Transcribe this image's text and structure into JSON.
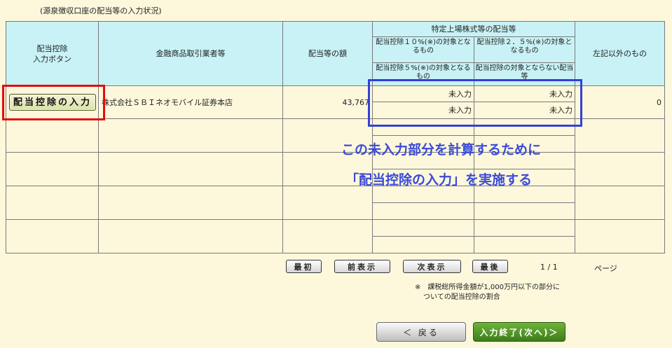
{
  "caption": "(源泉徴収口座の配当等の入力状況)",
  "table": {
    "headers": {
      "col1": "配当控除\n入力ボタン",
      "col2": "金融商品取引業者等",
      "col3": "配当等の額",
      "group": "特定上場株式等の配当等",
      "sub1": "配当控除１０%(※)の対象となるもの",
      "sub2": "配当控除２．５%(※)の対象となるもの",
      "sub3": "配当控除５%(※)の対象となるもの",
      "sub4": "配当控除の対象とならない配当等",
      "col6": "左記以外のもの"
    },
    "rows": [
      {
        "button_label": "配当控除の入力",
        "broker": "株式会社ＳＢＩネオモバイル証券本店",
        "amount": "43,767",
        "v1": "未入力",
        "v2": "未入力",
        "v3": "未入力",
        "v4": "未入力",
        "other": "0"
      }
    ]
  },
  "annotation": {
    "line1": "この未入力部分を計算するために",
    "line2": "「配当控除の入力」を実施する"
  },
  "pager": {
    "first": "最初",
    "prev": "前表示",
    "next": "次表示",
    "last": "最後",
    "page": "1 / 1",
    "page_label": "ページ"
  },
  "footnote": {
    "line1": "※　課税総所得金額が1,000万円以下の部分に",
    "line2": "ついての配当控除の割合"
  },
  "buttons": {
    "back": "＜ 戻る",
    "finish": "入力終了(次へ)＞"
  },
  "colors": {
    "header_bg": "#c8f2f5",
    "page_bg": "#fdf8dc",
    "highlight_red": "#e40d0d",
    "highlight_blue": "#3440d8"
  }
}
